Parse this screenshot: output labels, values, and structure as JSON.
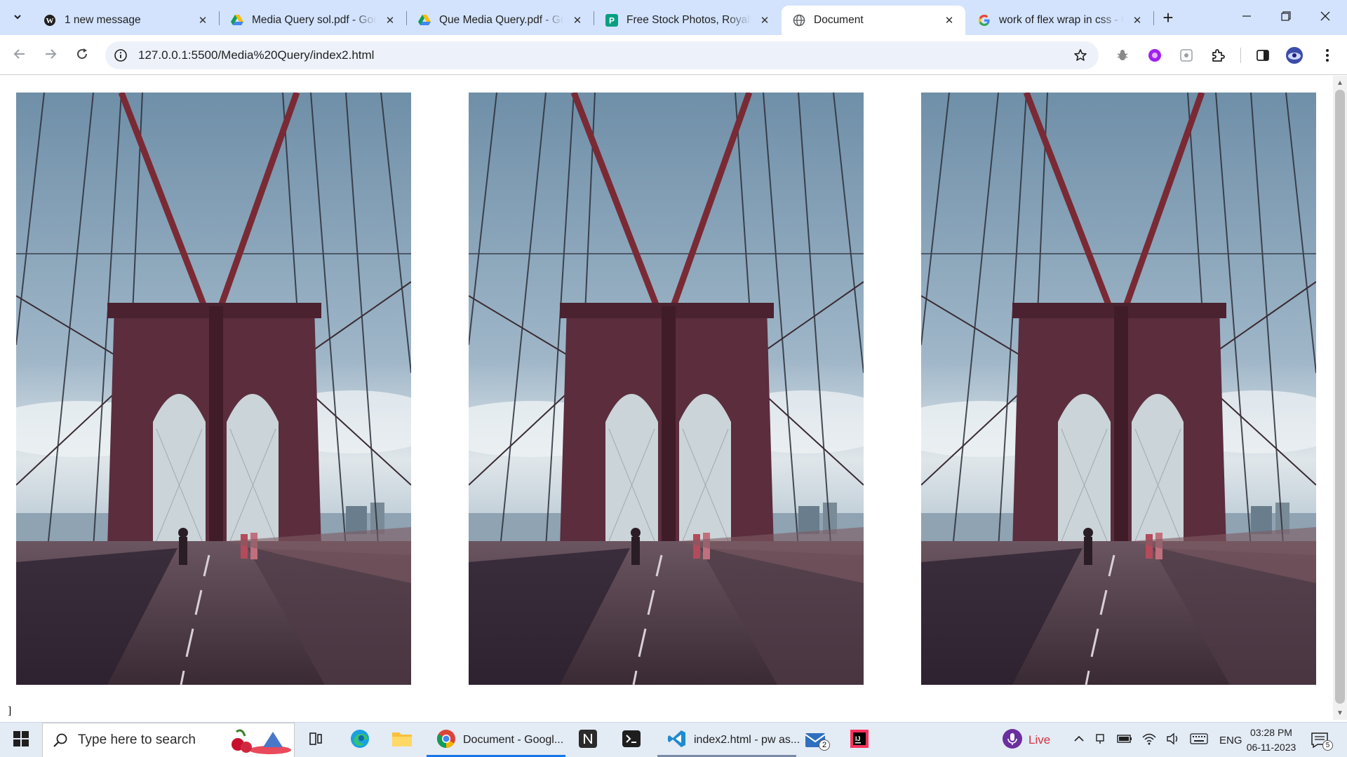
{
  "browser": {
    "tabs": [
      {
        "title": "1 new message",
        "icon": "wordpress-icon",
        "active": false
      },
      {
        "title": "Media Query sol.pdf - Google Drive",
        "icon": "google-drive-icon",
        "active": false
      },
      {
        "title": "Que Media Query.pdf - Google Drive",
        "icon": "google-drive-icon",
        "active": false
      },
      {
        "title": "Free Stock Photos, Royalty Free",
        "icon": "pexels-icon",
        "active": false
      },
      {
        "title": "Document",
        "icon": "globe-icon",
        "active": true
      },
      {
        "title": "work of flex wrap in css - Google Search",
        "icon": "google-icon",
        "active": false
      }
    ],
    "url": "127.0.0.1:5500/Media%20Query/index2.html"
  },
  "page": {
    "images": [
      {
        "subject": "Brooklyn Bridge tower and suspension cables"
      },
      {
        "subject": "Brooklyn Bridge tower and suspension cables"
      },
      {
        "subject": "Brooklyn Bridge tower and suspension cables"
      }
    ],
    "stray_text": "]"
  },
  "taskbar": {
    "search_placeholder": "Type here to search",
    "apps": [
      {
        "name": "task-view-icon"
      },
      {
        "name": "edge-icon"
      },
      {
        "name": "file-explorer-icon"
      },
      {
        "name": "chrome-icon",
        "label": "Document - Googl..."
      },
      {
        "name": "notion-icon"
      },
      {
        "name": "terminal-icon"
      },
      {
        "name": "vscode-icon",
        "label": "index2.html - pw as..."
      },
      {
        "name": "mail-icon",
        "badge": "2"
      },
      {
        "name": "intellij-icon"
      }
    ],
    "live_label": "Live",
    "language": "ENG",
    "time": "03:28 PM",
    "date": "06-11-2023",
    "notification_count": "5"
  },
  "colors": {
    "tabstrip": "#d3e3fd",
    "omnibox": "#edf2fa",
    "accent": "#1a73e8",
    "bridge_stone": "#5a2a3a",
    "sky": "#7c9bb5"
  }
}
